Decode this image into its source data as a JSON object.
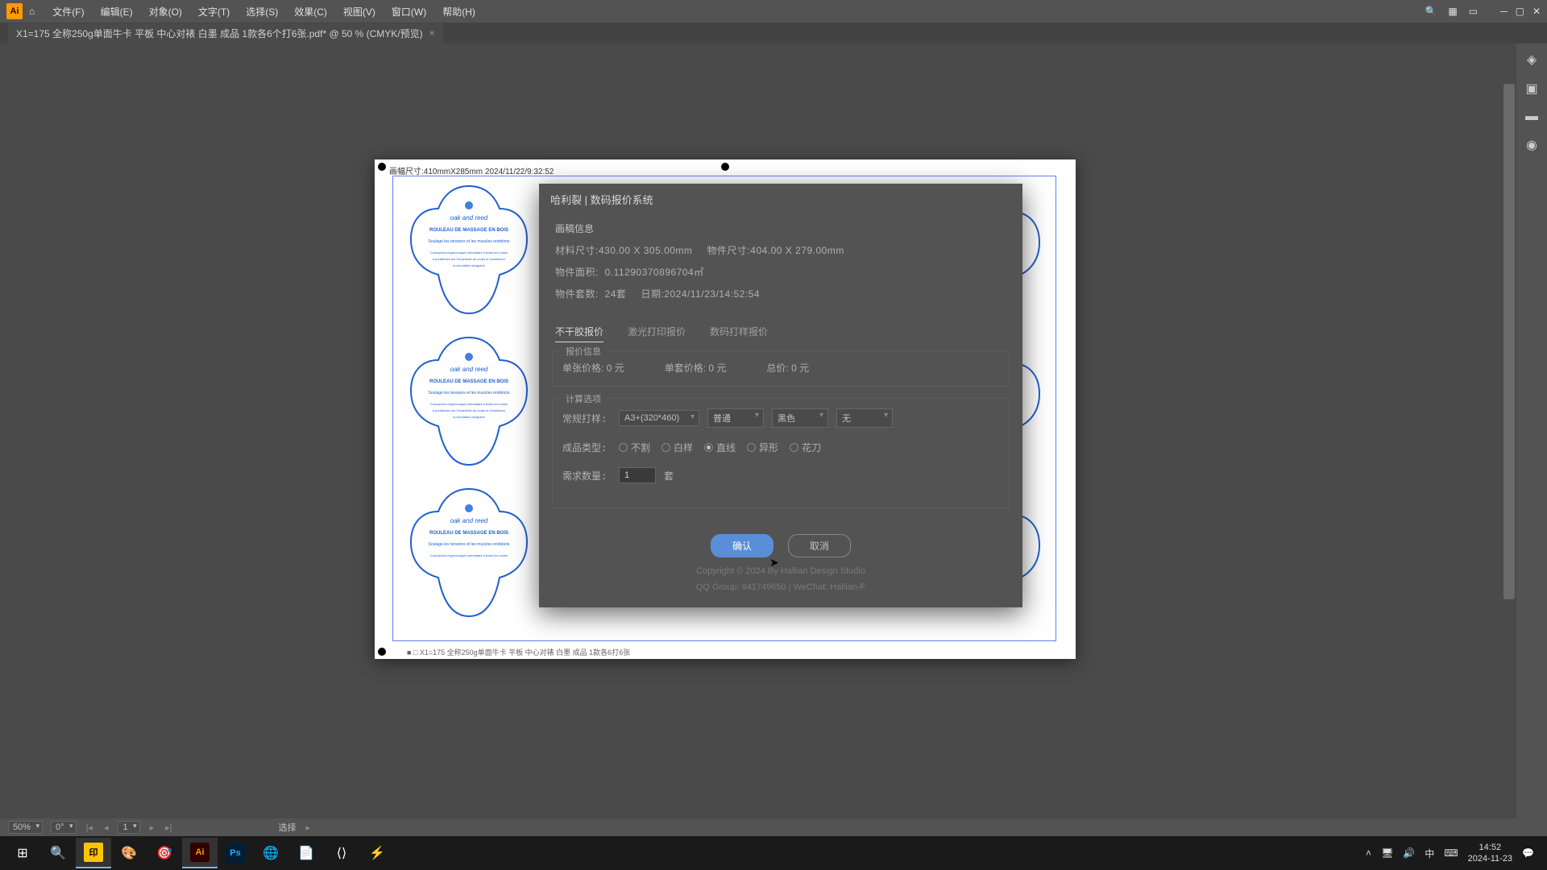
{
  "menu": {
    "file": "文件(F)",
    "edit": "编辑(E)",
    "object": "对象(O)",
    "type": "文字(T)",
    "select": "选择(S)",
    "effect": "效果(C)",
    "view": "视图(V)",
    "window": "窗口(W)",
    "help": "帮助(H)"
  },
  "tab": {
    "title": "X1=175  全称250g单面牛卡 平板  中心对裱  白墨  成品 1款各6个打6张.pdf* @ 50 % (CMYK/预览)",
    "close": "×"
  },
  "artboard": {
    "header": "画幅尺寸:410mmX285mm   2024/11/22/9:32:52",
    "footer": "X1=175  全称250g单面牛卡 平板  中心对裱  白墨 成品 1款各6打6张",
    "label_title": "ROULEAU DE MASSAGE EN BOIS",
    "label_brand": "oak and reed"
  },
  "dialog": {
    "title": "哈利裂 | 数码报价系统",
    "sec_info": "画稿信息",
    "material_label": "材料尺寸:",
    "material_value": "430.00 X 305.00mm",
    "object_label": "物件尺寸:",
    "object_value": "404.00 X 279.00mm",
    "area_label": "物件面积:",
    "area_value": "0.11290370896704㎡",
    "sets_label": "物件套数:",
    "sets_value": "24套",
    "date_label": "日期:",
    "date_value": "2024/11/23/14:52:54",
    "tabs": {
      "t1": "不干胶报价",
      "t2": "激光打印报价",
      "t3": "数码打样报价"
    },
    "quote_hd": "报价信息",
    "unit_price_label": "单张价格:",
    "unit_price_value": "0 元",
    "set_price_label": "单套价格:",
    "set_price_value": "0 元",
    "total_label": "总价:",
    "total_value": "0 元",
    "calc_hd": "计算选项",
    "normal_sample": "常规打样:",
    "size_sel": "A3+(320*460)",
    "quality_sel": "普通",
    "color_sel": "黑色",
    "finish_sel": "无",
    "product_type": "成品类型:",
    "radio": {
      "r1": "不割",
      "r2": "白样",
      "r3": "直线",
      "r4": "异形",
      "r5": "花刀"
    },
    "qty_label": "需求数量:",
    "qty_value": "1",
    "qty_unit": "套",
    "ok": "确认",
    "cancel": "取消",
    "copyright": "Copyright © 2024 By Hallian Design Studio",
    "contact": "QQ Group: 941749650 | WeChat: Hallian-F"
  },
  "status": {
    "zoom": "50%",
    "angle": "0°",
    "artboard_num": "1",
    "tool": "选择"
  },
  "taskbar": {
    "time": "14:52",
    "date": "2024-11-23",
    "ime": "中"
  }
}
